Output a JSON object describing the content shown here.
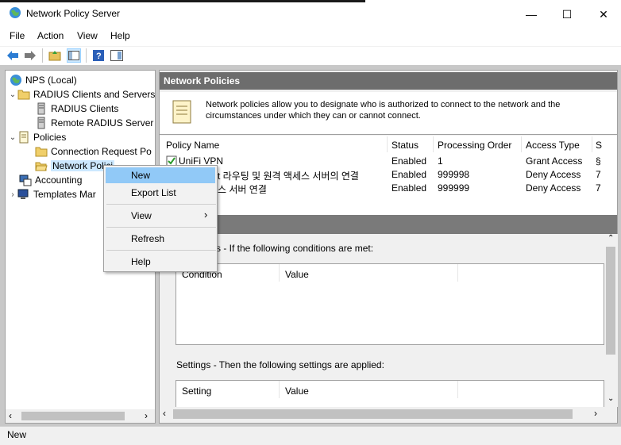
{
  "window": {
    "title": "Network Policy Server",
    "minimize": "—",
    "maximize": "☐",
    "close": "✕"
  },
  "menu": [
    "File",
    "Action",
    "View",
    "Help"
  ],
  "tree": {
    "root": "NPS (Local)",
    "radius_group": "RADIUS Clients and Servers",
    "radius_clients": "RADIUS Clients",
    "remote_radius": "Remote RADIUS Server",
    "policies": "Policies",
    "connection_request": "Connection Request Po",
    "network_policies": "Network Polici",
    "accounting": "Accounting",
    "templates": "Templates Mar"
  },
  "pane": {
    "header": "Network Policies",
    "description": "Network policies allow you to designate who is authorized to connect to the network and the circumstances under which they can or cannot connect.",
    "columns": [
      "Policy Name",
      "Status",
      "Processing Order",
      "Access Type",
      "S"
    ],
    "rows": [
      {
        "name": "UniFi VPN",
        "status": "Enabled",
        "order": "1",
        "access": "Grant Access",
        "s": "§"
      },
      {
        "name": "t 라우팅 및 원격 액세스 서버의 연결",
        "status": "Enabled",
        "order": "999998",
        "access": "Deny Access",
        "s": "7"
      },
      {
        "name": "스 서버 연결",
        "status": "Enabled",
        "order": "999999",
        "access": "Deny Access",
        "s": "7"
      }
    ],
    "conditions_label": "s - If the following conditions are met:",
    "cond_col1": "Condition",
    "cond_col2": "Value",
    "settings_label": "Settings - Then the following settings are applied:",
    "set_col1": "Setting",
    "set_col2": "Value"
  },
  "context_menu": {
    "new": "New",
    "export": "Export List",
    "view": "View",
    "view_arrow": "›",
    "refresh": "Refresh",
    "help": "Help"
  },
  "status": "New",
  "colors": {
    "selection": "#cce8ff",
    "ctx_highlight": "#91c9f7",
    "header": "#6d6d6d"
  }
}
